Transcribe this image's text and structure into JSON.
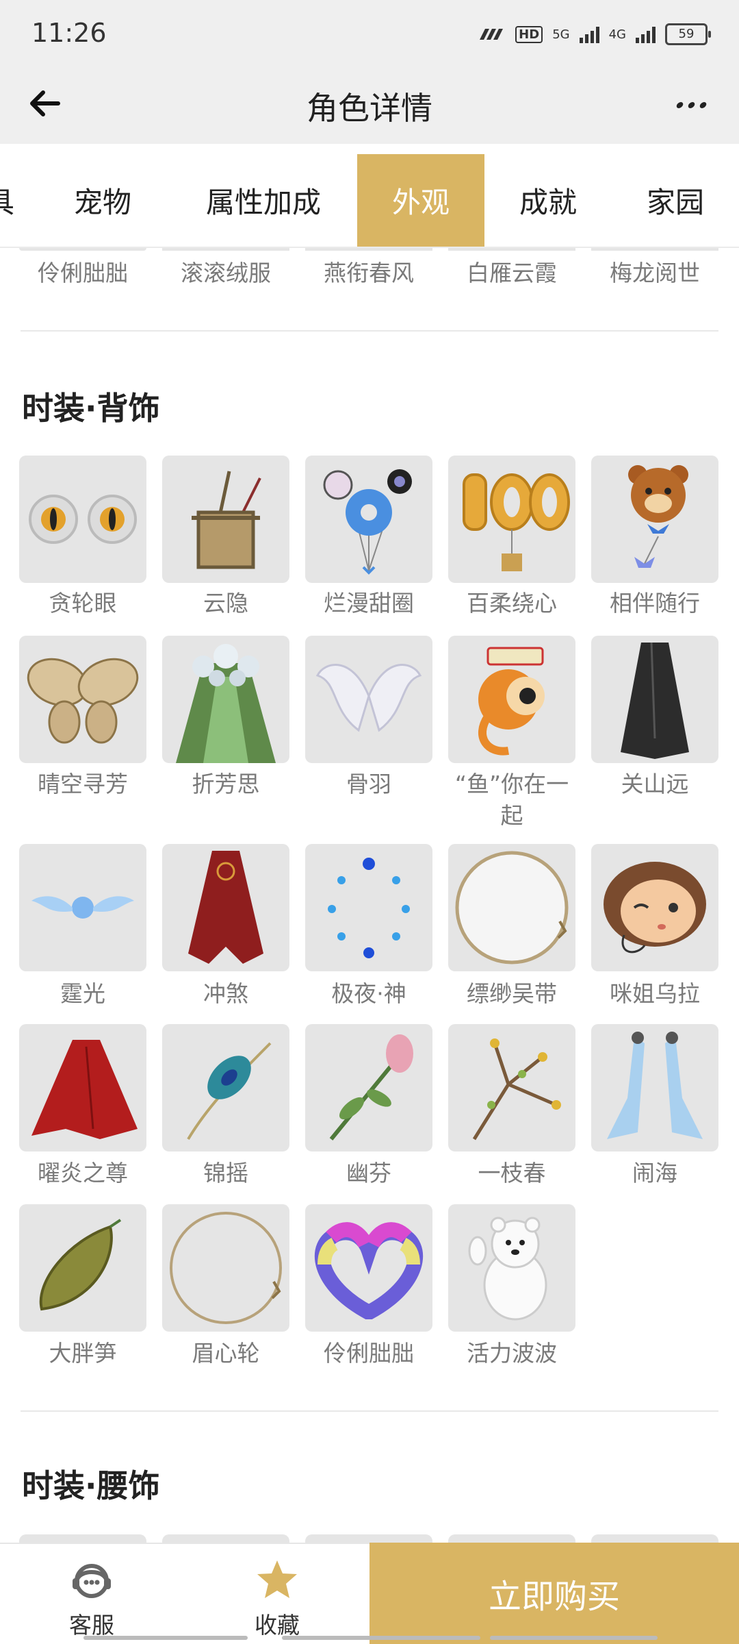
{
  "status_bar": {
    "time": "11:26",
    "hd_label": "HD",
    "net1": "5G",
    "net2": "4G",
    "battery": "59"
  },
  "header": {
    "title": "角色详情"
  },
  "tabs": [
    {
      "label": "具",
      "active": false
    },
    {
      "label": "宠物",
      "active": false
    },
    {
      "label": "属性加成",
      "active": false
    },
    {
      "label": "外观",
      "active": true
    },
    {
      "label": "成就",
      "active": false
    },
    {
      "label": "家园",
      "active": false
    }
  ],
  "prev_section_items": [
    "伶俐朏朏",
    "滚滚绒服",
    "燕衔春风",
    "白雁云霞",
    "梅龙阅世"
  ],
  "sections": [
    {
      "title": "时装·背饰",
      "items": [
        {
          "name": "贪轮眼",
          "icon": "eyes-icon"
        },
        {
          "name": "云隐",
          "icon": "basket-icon"
        },
        {
          "name": "烂漫甜圈",
          "icon": "donut-balloon-icon"
        },
        {
          "name": "百柔绕心",
          "icon": "100-balloon-icon"
        },
        {
          "name": "相伴随行",
          "icon": "bear-balloon-icon"
        },
        {
          "name": "晴空寻芳",
          "icon": "butterfly-wings-icon"
        },
        {
          "name": "折芳思",
          "icon": "flower-cape-icon"
        },
        {
          "name": "骨羽",
          "icon": "white-wings-icon"
        },
        {
          "name": "“鱼”你在一起",
          "icon": "fish-icon"
        },
        {
          "name": "关山远",
          "icon": "black-cape-icon"
        },
        {
          "name": "霆光",
          "icon": "light-wings-icon"
        },
        {
          "name": "冲煞",
          "icon": "red-cape-icon"
        },
        {
          "name": "极夜·神",
          "icon": "gem-ring-icon"
        },
        {
          "name": "缥缈吴带",
          "icon": "white-ring-icon"
        },
        {
          "name": "咪姐乌拉",
          "icon": "girl-face-icon"
        },
        {
          "name": "曜炎之尊",
          "icon": "red-cloak-icon"
        },
        {
          "name": "锦摇",
          "icon": "peacock-feather-icon"
        },
        {
          "name": "幽芬",
          "icon": "rose-icon"
        },
        {
          "name": "一枝春",
          "icon": "branch-icon"
        },
        {
          "name": "闹海",
          "icon": "blue-ribbons-icon"
        },
        {
          "name": "大胖笋",
          "icon": "bamboo-shoot-icon"
        },
        {
          "name": "眉心轮",
          "icon": "thin-ring-icon"
        },
        {
          "name": "伶俐朏朏",
          "icon": "fluffy-heart-icon"
        },
        {
          "name": "活力波波",
          "icon": "polar-bear-icon"
        }
      ]
    },
    {
      "title": "时装·腰饰",
      "items": []
    }
  ],
  "bottom_bar": {
    "service_label": "客服",
    "favorite_label": "收藏",
    "buy_label": "立即购买"
  },
  "colors": {
    "accent": "#d9b563",
    "tile_bg": "#e5e5e5",
    "label_gray": "#7a7a7a"
  }
}
